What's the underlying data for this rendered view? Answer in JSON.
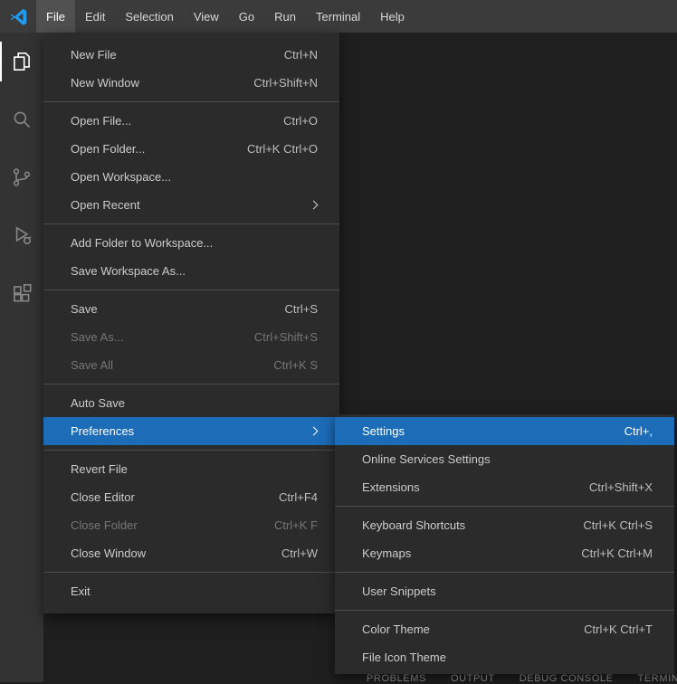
{
  "colors": {
    "accent_blue": "#1c6cb8",
    "logo_blue": "#1f9cf0"
  },
  "menu_bar": {
    "items": [
      {
        "label": "File",
        "active": true
      },
      {
        "label": "Edit"
      },
      {
        "label": "Selection"
      },
      {
        "label": "View"
      },
      {
        "label": "Go"
      },
      {
        "label": "Run"
      },
      {
        "label": "Terminal"
      },
      {
        "label": "Help"
      }
    ]
  },
  "activity_bar": {
    "items": [
      {
        "icon": "explorer-icon",
        "active": true
      },
      {
        "icon": "search-icon"
      },
      {
        "icon": "source-control-icon"
      },
      {
        "icon": "run-debug-icon"
      },
      {
        "icon": "extensions-icon"
      }
    ]
  },
  "file_menu": {
    "items": [
      {
        "label": "New File",
        "shortcut": "Ctrl+N"
      },
      {
        "label": "New Window",
        "shortcut": "Ctrl+Shift+N"
      },
      {
        "label": "Open File...",
        "shortcut": "Ctrl+O"
      },
      {
        "label": "Open Folder...",
        "shortcut": "Ctrl+K Ctrl+O"
      },
      {
        "label": "Open Workspace...",
        "shortcut": ""
      },
      {
        "label": "Open Recent",
        "shortcut": "",
        "submenu": true
      },
      {
        "label": "Add Folder to Workspace...",
        "shortcut": ""
      },
      {
        "label": "Save Workspace As...",
        "shortcut": ""
      },
      {
        "label": "Save",
        "shortcut": "Ctrl+S"
      },
      {
        "label": "Save As...",
        "shortcut": "Ctrl+Shift+S",
        "disabled": true
      },
      {
        "label": "Save All",
        "shortcut": "Ctrl+K S",
        "disabled": true
      },
      {
        "label": "Auto Save",
        "shortcut": ""
      },
      {
        "label": "Preferences",
        "shortcut": "",
        "submenu": true,
        "selected": true
      },
      {
        "label": "Revert File",
        "shortcut": ""
      },
      {
        "label": "Close Editor",
        "shortcut": "Ctrl+F4"
      },
      {
        "label": "Close Folder",
        "shortcut": "Ctrl+K F",
        "disabled": true
      },
      {
        "label": "Close Window",
        "shortcut": "Ctrl+W"
      },
      {
        "label": "Exit",
        "shortcut": ""
      }
    ]
  },
  "preferences_menu": {
    "items": [
      {
        "label": "Settings",
        "shortcut": "Ctrl+,",
        "selected": true
      },
      {
        "label": "Online Services Settings",
        "shortcut": ""
      },
      {
        "label": "Extensions",
        "shortcut": "Ctrl+Shift+X"
      },
      {
        "label": "Keyboard Shortcuts",
        "shortcut": "Ctrl+K Ctrl+S"
      },
      {
        "label": "Keymaps",
        "shortcut": "Ctrl+K Ctrl+M"
      },
      {
        "label": "User Snippets",
        "shortcut": ""
      },
      {
        "label": "Color Theme",
        "shortcut": "Ctrl+K Ctrl+T"
      },
      {
        "label": "File Icon Theme",
        "shortcut": ""
      }
    ]
  },
  "panel": {
    "tabs": [
      {
        "label": "PROBLEMS"
      },
      {
        "label": "OUTPUT"
      },
      {
        "label": "DEBUG CONSOLE"
      },
      {
        "label": "TERMINAL"
      }
    ]
  }
}
